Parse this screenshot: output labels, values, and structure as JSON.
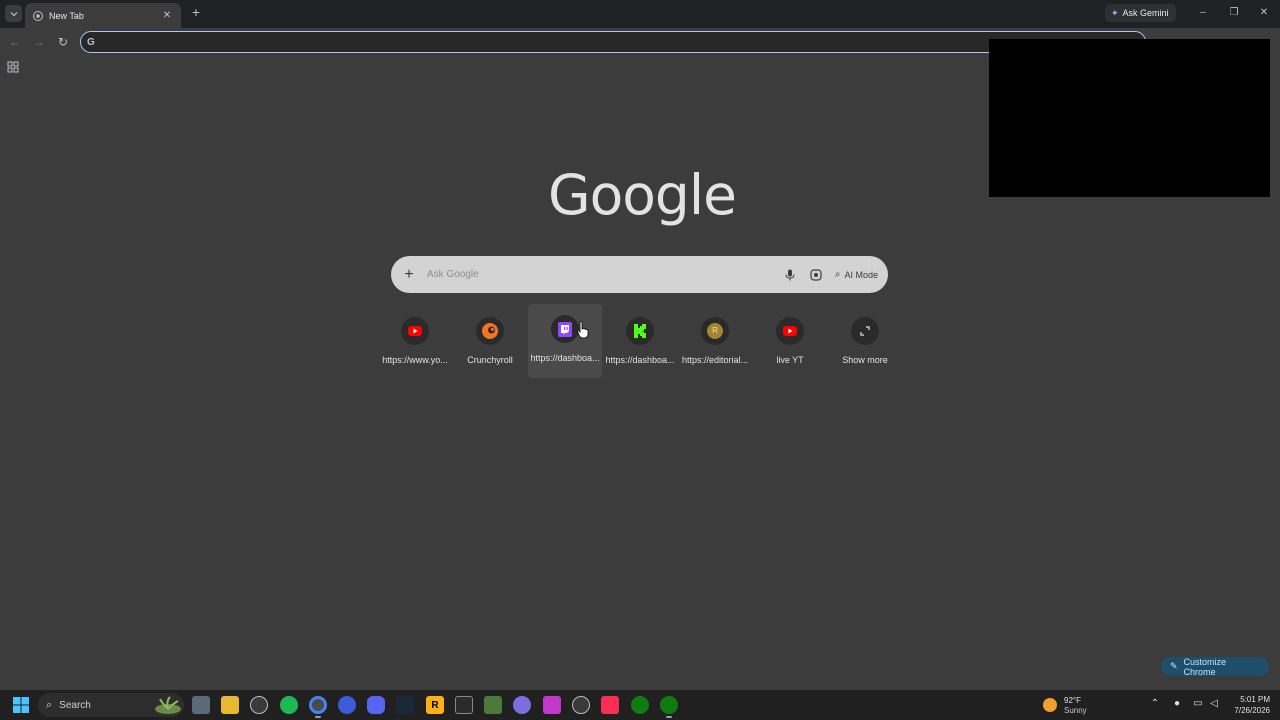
{
  "window": {
    "tab_title": "New Tab",
    "ask_gemini_label": "Ask Gemini"
  },
  "search": {
    "placeholder": "Ask Google",
    "ai_mode_label": "AI Mode"
  },
  "logo_text": "Google",
  "shortcuts": [
    {
      "label": "https://www.yo...",
      "icon": "youtube-icon",
      "color": "#ff0000"
    },
    {
      "label": "Crunchyroll",
      "icon": "crunchyroll-icon",
      "color": "#f47521"
    },
    {
      "label": "https://dashboa...",
      "icon": "twitch-icon",
      "color": "#9146ff"
    },
    {
      "label": "https://dashboa...",
      "icon": "kick-icon",
      "color": "#53fc18"
    },
    {
      "label": "https://editorial...",
      "icon": "letter-r-icon",
      "color": "#a3862e",
      "letter": "R"
    },
    {
      "label": "live YT",
      "icon": "youtube-icon",
      "color": "#ff0000"
    },
    {
      "label": "Show more",
      "icon": "expand-icon"
    }
  ],
  "customize_label": "Customize Chrome",
  "taskbar": {
    "search_label": "Search",
    "weather_temp": "92°F",
    "weather_cond": "Sunny",
    "time": "5:01 PM",
    "date": "7/26/2026",
    "rockstar_letter": "R"
  },
  "colors": {
    "accent": "#a8c7fa",
    "background": "#3c3c3c",
    "customize_bg": "#1f4e6b"
  }
}
